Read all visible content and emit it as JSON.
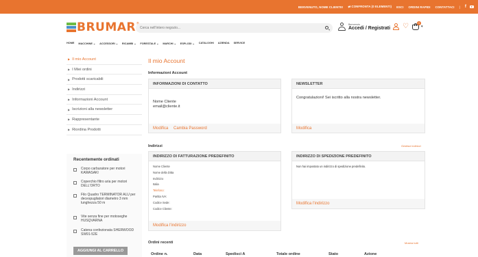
{
  "topbar": {
    "welcome": "BENVENUTO, NOME CLIENTE!",
    "compare": "CONFRONTA (0 ELEMENTI)",
    "logout": "ESCI",
    "quick_orders": "ORDINI RAPIDI",
    "contacts": "CONTATTACI",
    "separator": "|",
    "facebook": "f",
    "accent_color": "#e8742f"
  },
  "logo": {
    "text": "BRUMAR",
    "reg": "®"
  },
  "search": {
    "placeholder": "Cerca nell'intero negozio..."
  },
  "account": {
    "welcome_small": "Benvenuto",
    "label": "Accedi / Registrati",
    "cart_count": "0"
  },
  "nav": {
    "items": [
      "HOME",
      "MACCHINE ⌄",
      "ACCESSORI ⌄",
      "RICAMBI ⌄",
      "FORESTALE ⌄",
      "MARCHI ⌄",
      "ESPLODI ⌄",
      "CATALOGHI",
      "AZIENDA",
      "SERVICE"
    ]
  },
  "sidebar": {
    "items": [
      {
        "label": "Il mio Account",
        "active": true
      },
      {
        "label": "I Miei ordini"
      },
      {
        "label": "Prodotti scaricabili"
      },
      {
        "label": "Indirizzi"
      },
      {
        "label": "Informazioni Account"
      },
      {
        "label": "Iscrizioni alla newsletter"
      },
      {
        "label": "Rappresentante"
      },
      {
        "label": "Riordina Prodotti"
      }
    ]
  },
  "recent": {
    "title": "Recentemente ordinati",
    "items": [
      "Corpo carburatore per motori KAWASAKI",
      "Coperchio filtro aria per motori DELL'ORTO",
      "Filo Quadro TERMINATOR ALU per decespugliatori diametro 3 mm lunghezza 50 m",
      "Vite senza fine per motoseghe HUSQVARNA",
      "Catena confezionata SHERWOOD SW91-52E"
    ],
    "add_to_cart": "AGGIUNGI AL CARRELLO"
  },
  "main": {
    "title": "Il mio Account",
    "account_info_title": "Informazioni Account",
    "contact": {
      "header": "INFORMAZIONI DI CONTATTO",
      "name": "Nome Cliente",
      "email": "email@cliente.it",
      "edit": "Modifica",
      "change_pw": "Cambia Password"
    },
    "newsletter": {
      "header": "NEWSLETTER",
      "text": "Congratulazioni! Sei iscritto alla nostra newsletter.",
      "edit": "Modifica"
    },
    "addresses_title": "Indirizzi",
    "manage_addresses": "Gestisci indirizzi",
    "billing": {
      "header": "INDIRIZZO DI FATTURAZIONE PREDEFINITO",
      "lines": [
        "Nome Cliente",
        "Nome della Ditta",
        "Indirizzo",
        "Italia",
        "Telefono:",
        "Partita IVA:",
        "Codice Sede:",
        "Codice Cliente:"
      ],
      "edit": "Modifica l'indirizzo"
    },
    "shipping": {
      "header": "INDIRIZZO DI SPEDIZIONE PREDEFINITO",
      "text": "Non hai impostato un indirizzo di spedizione predefinito.",
      "edit": "Modifica l'indirizzo"
    },
    "orders_title": "Ordini recenti",
    "show_all": "Mostra tutti",
    "columns": [
      "Ordine n.",
      "Data",
      "Spedisci A",
      "Totale ordine",
      "Stato",
      "Azione"
    ]
  }
}
